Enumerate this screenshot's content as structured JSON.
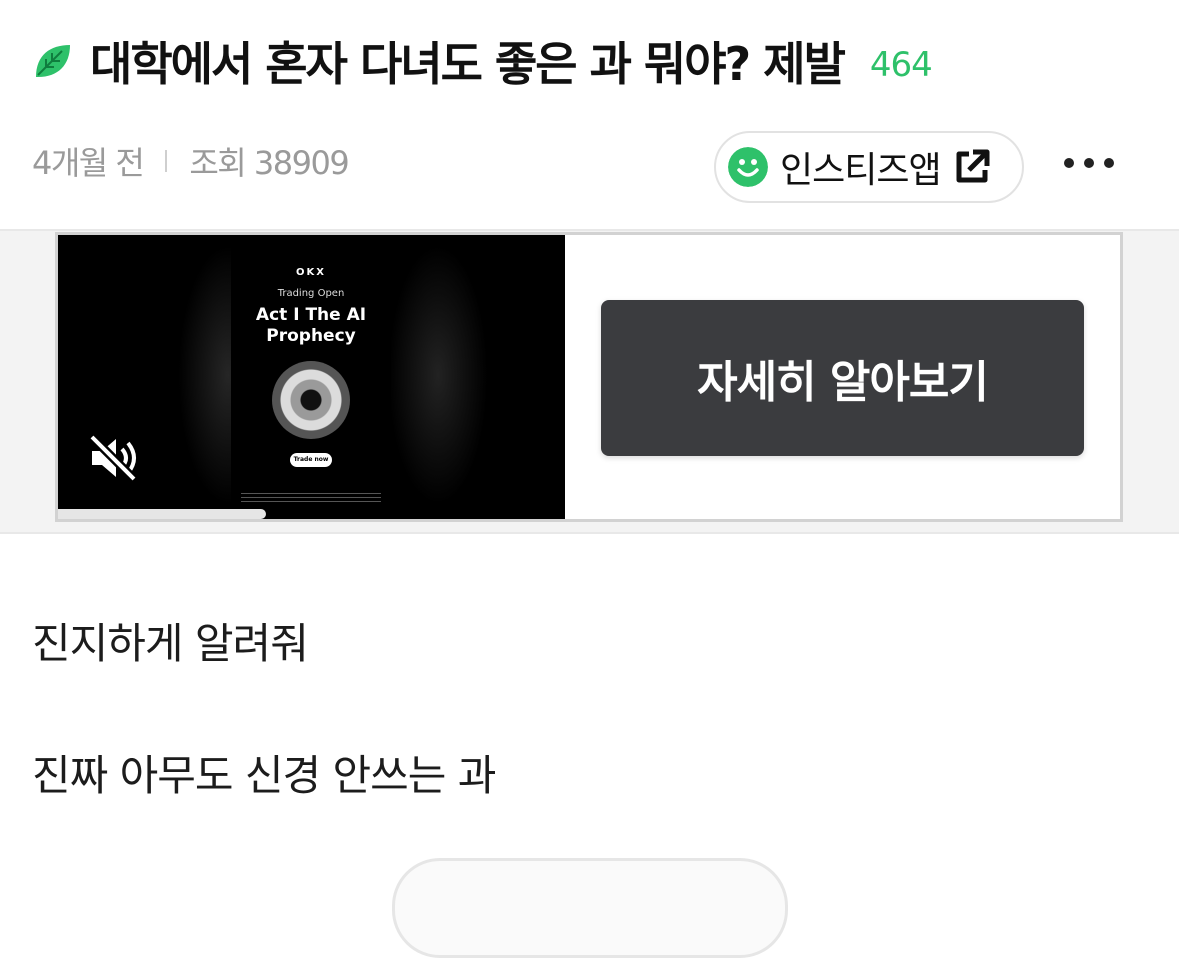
{
  "post": {
    "title": "대학에서 혼자 다녀도 좋은 과 뭐야? 제발",
    "comment_count": "464",
    "time_ago": "4개월 전",
    "views_label": "조회 38909"
  },
  "app_link": {
    "label": "인스티즈앱",
    "icon": "smiley-logo-icon",
    "external_icon": "external-link-icon"
  },
  "more_menu": {
    "icon": "more-dots-icon"
  },
  "ad": {
    "brand": "OKX",
    "subtitle": "Trading Open",
    "headline_line1": "Act I The AI",
    "headline_line2": "Prophecy",
    "cta_small": "Trade now",
    "mute_icon": "muted-speaker-icon",
    "progress": 0.41,
    "learn_more": "자세히 알아보기"
  },
  "body": {
    "line1": "진지하게 알려줘",
    "line2": "진짜 아무도 신경 안쓰는 과"
  },
  "colors": {
    "accent_green": "#2ec16a",
    "button_dark": "#3b3c3f",
    "meta_gray": "#9a9a9a"
  }
}
